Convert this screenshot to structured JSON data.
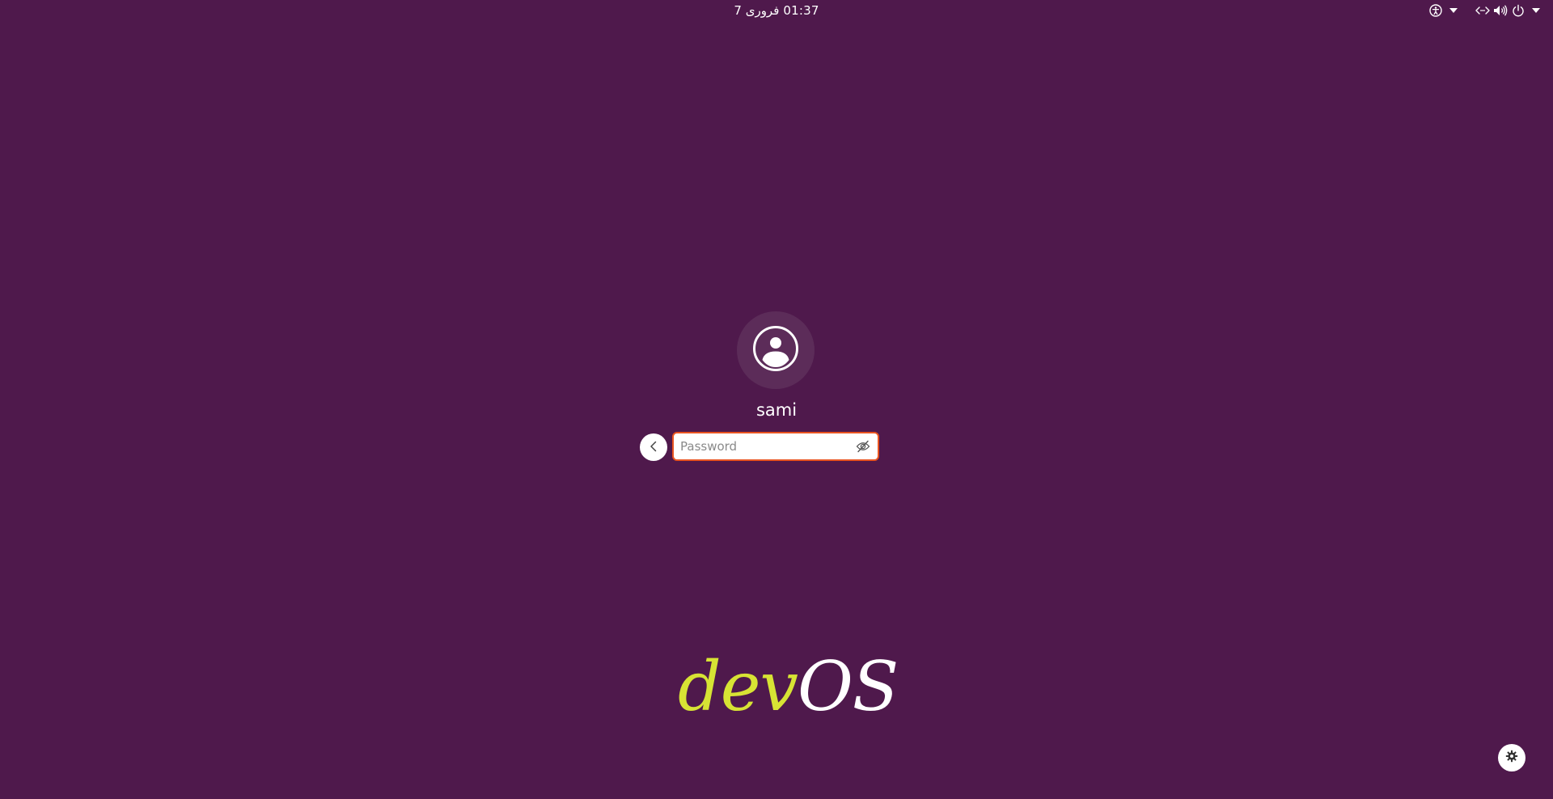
{
  "topbar": {
    "clock_date": "فروری 7",
    "clock_time": "01:37"
  },
  "tray": {
    "icons": [
      "accessibility-icon",
      "dropdown-arrow-icon",
      "network-icon",
      "volume-icon",
      "power-icon",
      "system-menu-arrow-icon"
    ]
  },
  "login": {
    "username": "sami",
    "password_placeholder": "Password",
    "back_icon": "chevron-left-icon",
    "reveal_icon": "eye-slash-icon",
    "avatar_icon": "user-avatar-icon"
  },
  "brand": {
    "part1": "dev",
    "part2": "OS",
    "color_dev": "#d7e334",
    "color_os": "#ffffff"
  },
  "settings": {
    "icon": "gear-icon"
  },
  "colors": {
    "background": "#4f194c",
    "accent": "#e95420"
  }
}
